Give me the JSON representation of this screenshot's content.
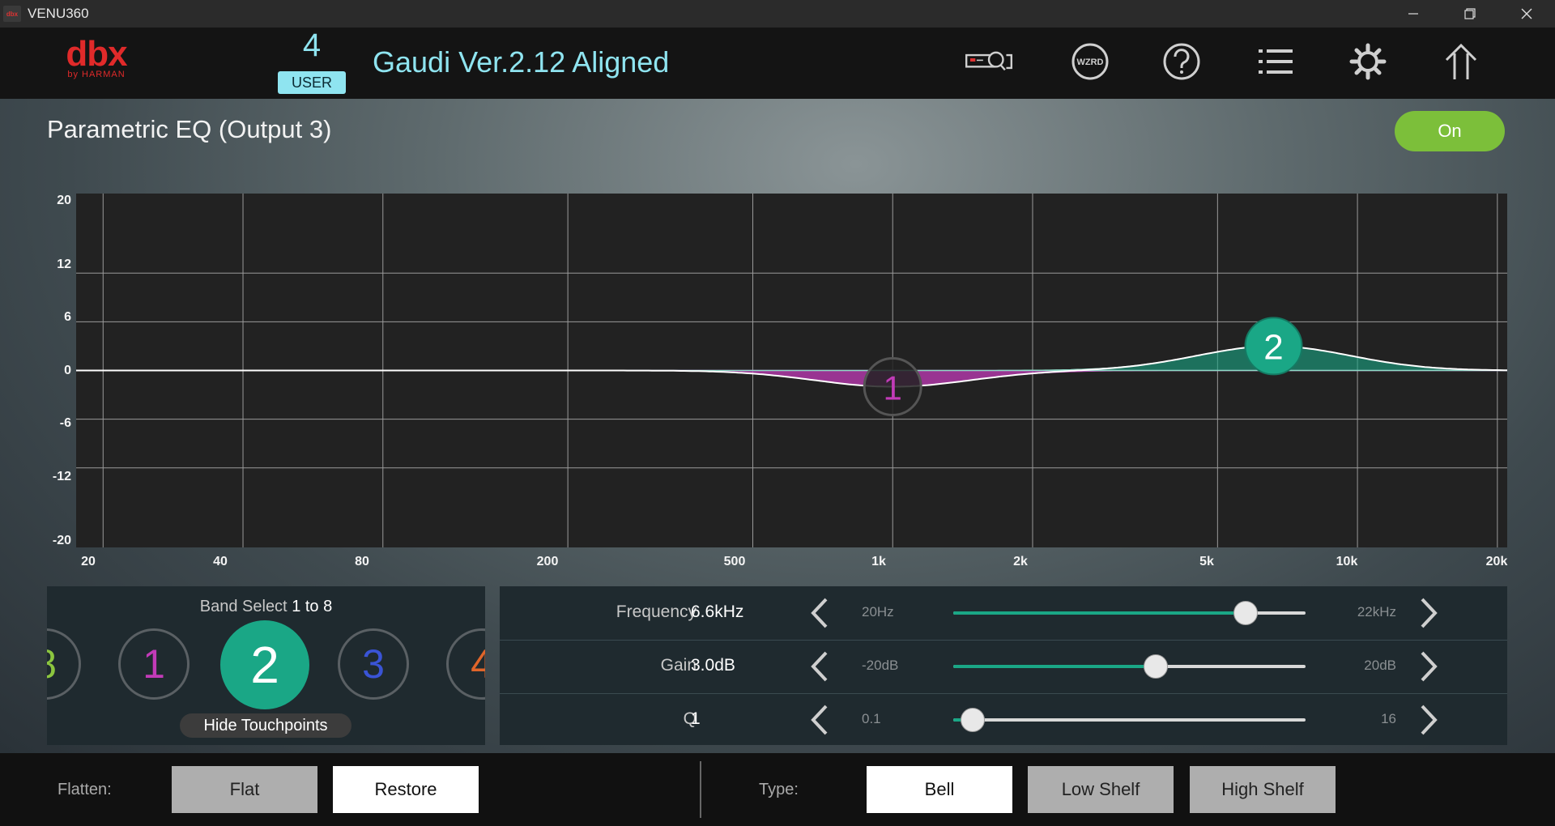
{
  "window": {
    "title": "VENU360",
    "icon": "dbx-app-icon"
  },
  "header": {
    "logo_main": "dbx",
    "logo_sub": "by HARMAN",
    "preset_number": "4",
    "preset_type": "USER",
    "preset_name": "Gaudi Ver.2.12 Aligned",
    "icons": [
      "device-search-icon",
      "wizard-icon",
      "help-icon",
      "list-icon",
      "settings-gear-icon",
      "home-icon"
    ],
    "wizard_text": "WZRD"
  },
  "page": {
    "title": "Parametric EQ  (Output 3)",
    "power_label": "On"
  },
  "colors": {
    "accent": "#1aa786",
    "band1": "#c23bb8",
    "band3": "#3a54d6",
    "band4": "#e0652a",
    "band8": "#8cc63f",
    "on": "#7cbf3a",
    "preset": "#8fe4f0"
  },
  "graph": {
    "y_ticks": [
      "20",
      "12",
      "6",
      "0",
      "-6",
      "-12",
      "-20"
    ],
    "x_ticks": [
      "20",
      "40",
      "80",
      "200",
      "500",
      "1k",
      "2k",
      "5k",
      "10k",
      "20k"
    ],
    "handles": [
      {
        "label": "1",
        "freq_hz": 1000,
        "gain_db": -2.0,
        "q": 1
      },
      {
        "label": "2",
        "freq_hz": 6600,
        "gain_db": 3.0,
        "q": 1
      }
    ]
  },
  "band_select": {
    "title_prefix": "Band Select ",
    "title_range": "1 to 8",
    "bands": [
      "8",
      "1",
      "2",
      "3",
      "4"
    ],
    "selected": "2",
    "hide_label": "Hide Touchpoints"
  },
  "params": {
    "frequency": {
      "label": "Frequency",
      "value": "6.6kHz",
      "min": "20Hz",
      "max": "22kHz",
      "position": 0.83
    },
    "gain": {
      "label": "Gain",
      "value": "3.0dB",
      "min": "-20dB",
      "max": "20dB",
      "position": 0.575
    },
    "q": {
      "label": "Q",
      "value": "1",
      "min": "0.1",
      "max": "16",
      "position": 0.055
    }
  },
  "bottom": {
    "flatten_label": "Flatten:",
    "flat": "Flat",
    "restore": "Restore",
    "type_label": "Type:",
    "bell": "Bell",
    "low_shelf": "Low Shelf",
    "high_shelf": "High Shelf"
  }
}
